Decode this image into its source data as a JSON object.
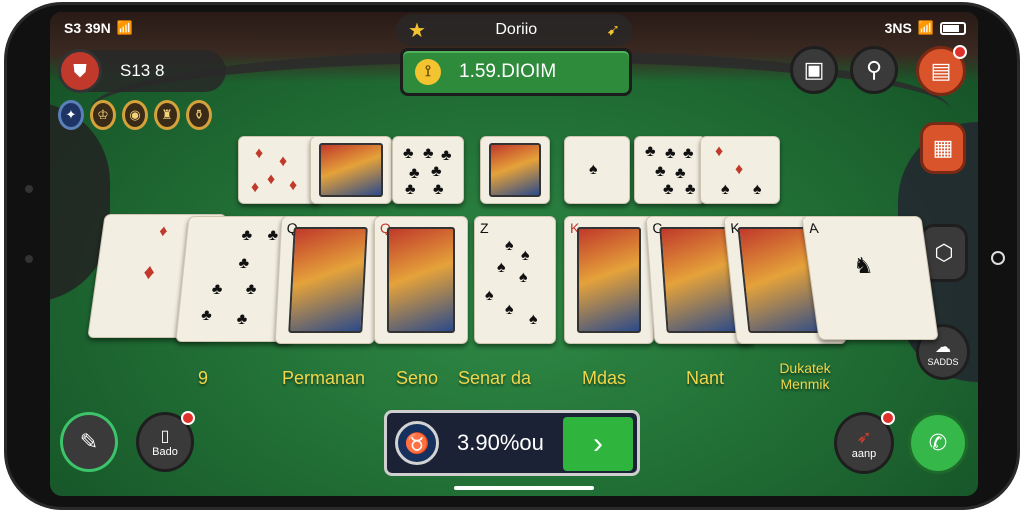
{
  "status_bar": {
    "left_text": "S3 39N",
    "right_text": "3NS"
  },
  "title_bar": {
    "title": "Doriio",
    "star_icon": "star-icon",
    "arrow_icon": "arrow-icon"
  },
  "profile": {
    "name": "S13 8"
  },
  "balance": {
    "value": "1.59.DIOIM"
  },
  "slot_labels": [
    "9",
    "Permanan",
    "Seno",
    "Senar da",
    "Mdas",
    "Nant",
    "Dukatek Menmik"
  ],
  "left_bottom_button": {
    "label": "Bado"
  },
  "right_buttons": {
    "speech_label": "SADDS"
  },
  "right_bottom_button": {
    "label": "aanp"
  },
  "bet": {
    "value": "3.90%ou"
  },
  "colors": {
    "felt": "#2f8a45",
    "accent_gold": "#f1d64a",
    "go_green": "#2fb43e"
  }
}
